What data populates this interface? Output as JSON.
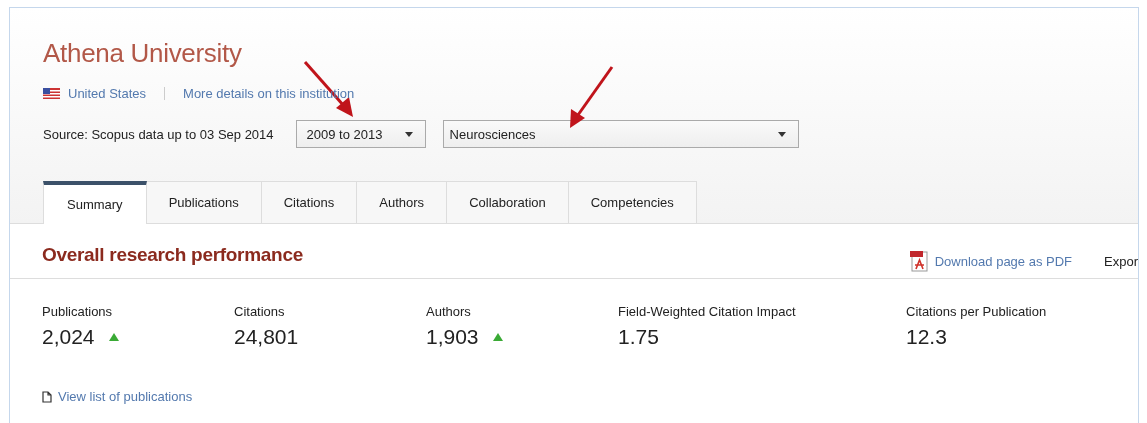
{
  "institution": {
    "name": "Athena University",
    "country": "United States",
    "details_link": "More details on this institution"
  },
  "filters": {
    "source": "Source: Scopus data up to 03 Sep 2014",
    "year_range": "2009 to 2013",
    "subject": "Neurosciences"
  },
  "tabs": [
    {
      "label": "Summary",
      "selected": true
    },
    {
      "label": "Publications",
      "selected": false
    },
    {
      "label": "Citations",
      "selected": false
    },
    {
      "label": "Authors",
      "selected": false
    },
    {
      "label": "Collaboration",
      "selected": false
    },
    {
      "label": "Competencies",
      "selected": false
    }
  ],
  "section": {
    "title": "Overall research performance",
    "download_link": "Download page as PDF",
    "export": "Expor"
  },
  "metrics": [
    {
      "label": "Publications",
      "value": "2,024",
      "trend_up": true
    },
    {
      "label": "Citations",
      "value": "24,801",
      "trend_up": false
    },
    {
      "label": "Authors",
      "value": "1,903",
      "trend_up": true
    },
    {
      "label": "Field-Weighted Citation Impact",
      "value": "1.75",
      "trend_up": false
    },
    {
      "label": "Citations per Publication",
      "value": "12.3",
      "trend_up": false
    }
  ],
  "view_link": "View list of publications"
}
